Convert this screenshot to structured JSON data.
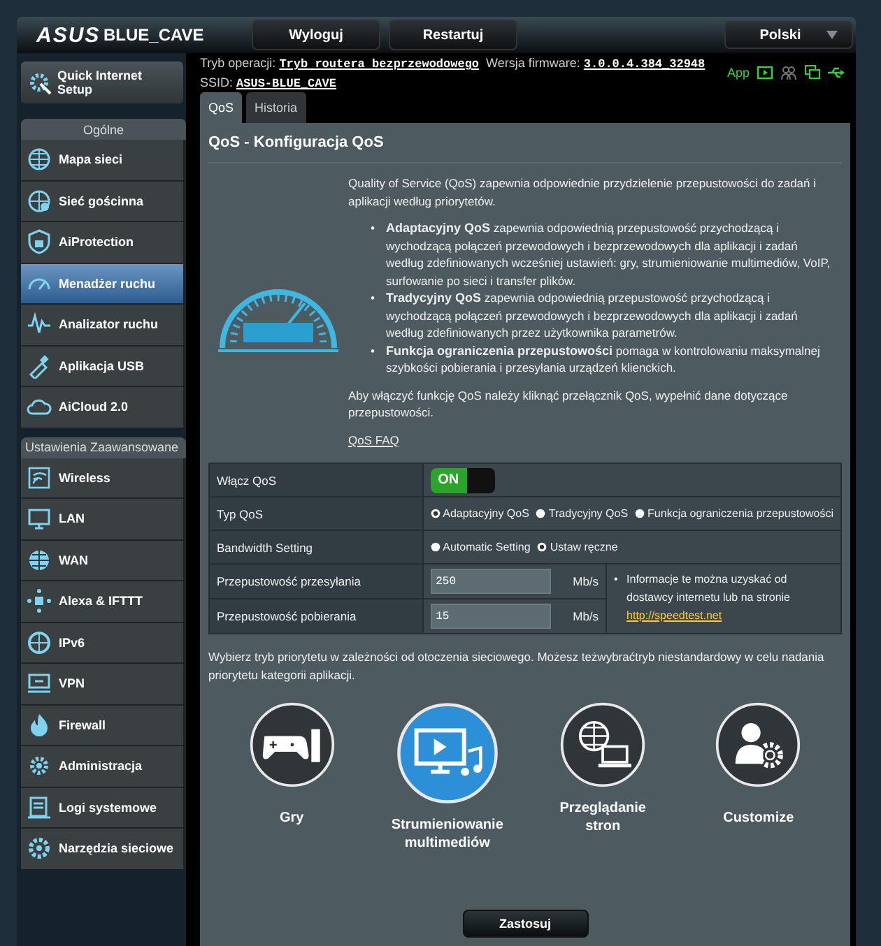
{
  "header": {
    "logo": "ASUS",
    "model": "BLUE_CAVE",
    "buttons": [
      "Wyloguj",
      "Restartuj"
    ],
    "language": "Polski"
  },
  "sidebar": {
    "quick_setup": "Quick Internet Setup",
    "sections": [
      {
        "title": "Ogólne",
        "items": [
          {
            "label": "Mapa sieci",
            "selected": false
          },
          {
            "label": "Sieć gościnna",
            "selected": false
          },
          {
            "label": "AiProtection",
            "selected": false
          },
          {
            "label": "Menadżer ruchu",
            "selected": true
          },
          {
            "label": "Analizator ruchu",
            "selected": false
          },
          {
            "label": "Aplikacja USB",
            "selected": false
          },
          {
            "label": "AiCloud 2.0",
            "selected": false
          }
        ]
      },
      {
        "title": "Ustawienia Zaawansowane",
        "items": [
          {
            "label": "Wireless",
            "selected": false
          },
          {
            "label": "LAN",
            "selected": false
          },
          {
            "label": "WAN",
            "selected": false
          },
          {
            "label": "Alexa & IFTTT",
            "selected": false
          },
          {
            "label": "IPv6",
            "selected": false
          },
          {
            "label": "VPN",
            "selected": false
          },
          {
            "label": "Firewall",
            "selected": false
          },
          {
            "label": "Administracja",
            "selected": false
          },
          {
            "label": "Logi systemowe",
            "selected": false
          },
          {
            "label": "Narzędzia sieciowe",
            "selected": false
          }
        ]
      }
    ]
  },
  "info": {
    "mode_label": "Tryb operacji:",
    "mode": "Tryb routera bezprzewodowego",
    "firmware_label": "Wersja firmware:",
    "firmware": "3.0.0.4.384_32948",
    "ssid_label": "SSID:",
    "ssid": "ASUS-BLUE_CAVE",
    "app_label": "App"
  },
  "tabs": [
    {
      "label": "QoS",
      "selected": true
    },
    {
      "label": "Historia",
      "selected": false
    }
  ],
  "panel": {
    "title": "QoS - Konfiguracja QoS",
    "intro": "Quality of Service (QoS) zapewnia odpowiednie przydzielenie przepustowości do zadań i aplikacji według priorytetów.",
    "bullets": [
      {
        "marker": "•",
        "text": "**Adaptacyjny QoS** zapewnia odpowiednią przepustowość przychodzącą i wychodzącą połączeń przewodowych i bezprzewodowych dla aplikacji i zadań według zdefiniowanych wcześniej ustawień: gry, strumieniowanie multimediów, VoIP, surfowanie po sieci i transfer plików."
      },
      {
        "marker": "•",
        "text": "**Tradycyjny QoS** zapewnia odpowiednią przepustowość przychodzącą i wychodzącą połączeń przewodowych i bezprzewodowych dla aplikacji i zadań według zdefiniowanych przez użytkownika parametrów."
      },
      {
        "marker": "•",
        "text": "**Funkcja ograniczenia przepustowości** pomaga w kontrolowaniu maksymalnej szybkości pobierania i przesyłania urządzeń klienckich."
      }
    ],
    "note": "Aby włączyć funkcję QoS należy kliknąć przełącznik QoS, wypełnić dane dotyczące przepustowości.",
    "faq_link": "QoS FAQ"
  },
  "settings": {
    "enable": {
      "label": "Włącz QoS",
      "on": true,
      "on_label": "ON"
    },
    "qos_type": {
      "label": "Typ QoS",
      "options": [
        {
          "label": "Adaptacyjny QoS",
          "selected": true
        },
        {
          "label": "Tradycyjny QoS",
          "selected": false
        },
        {
          "label": "Funkcja ograniczenia przepustowości",
          "selected": false
        }
      ]
    },
    "bandwidth": {
      "label": "Bandwidth Setting",
      "options": [
        {
          "label": "Automatic Setting",
          "selected": false
        },
        {
          "label": "Ustaw ręczne",
          "selected": true
        }
      ]
    },
    "upload": {
      "label": "Przepustowość przesyłania",
      "value": "250",
      "unit": "Mb/s"
    },
    "download": {
      "label": "Przepustowość pobierania",
      "value": "15",
      "unit": "Mb/s"
    },
    "hint_marker": "•",
    "hint": "Informacje te można uzyskać od dostawcy internetu lub na stronie",
    "hint_link": "http://speedtest.net"
  },
  "priority": {
    "text": "Wybierz tryb priorytetu w zależności od otoczenia sieciowego. Możesz teżwybraćtryb niestandardowy w celu nadania priorytetu kategorii aplikacji.",
    "modes": [
      {
        "kind": "games",
        "label": "Gry",
        "selected": false
      },
      {
        "kind": "streaming",
        "label": "Strumieniowanie multimediów",
        "selected": true
      },
      {
        "kind": "browsing",
        "label": "Przeglądanie stron",
        "selected": false
      },
      {
        "kind": "custom",
        "label": "Customize",
        "selected": false
      }
    ]
  },
  "apply": "Zastosuj"
}
